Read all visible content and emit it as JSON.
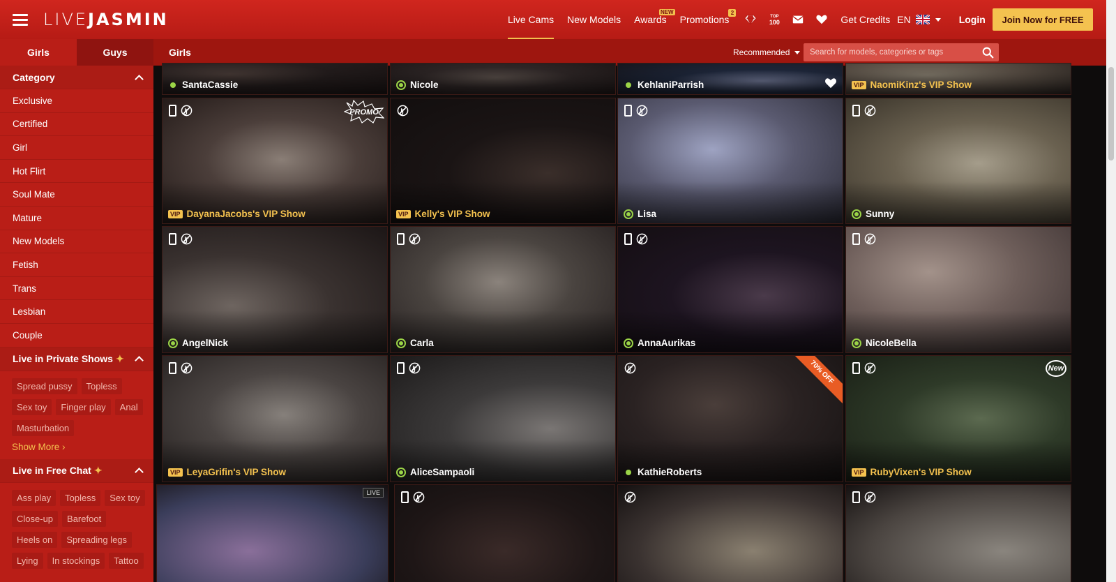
{
  "brand": {
    "logo_thin": "LIVE",
    "logo_bold": "JASMIN"
  },
  "nav": {
    "live_cams": "Live Cams",
    "new_models": "New Models",
    "awards": "Awards",
    "awards_badge": "NEW",
    "promotions": "Promotions",
    "promotions_count": "2",
    "top100_line1": "TOP",
    "top100_line2": "100",
    "get_credits": "Get Credits",
    "lang": "EN",
    "login": "Login",
    "join": "Join Now for FREE"
  },
  "sidebar": {
    "tabs": [
      "Girls",
      "Guys"
    ],
    "category_title": "Category",
    "categories": [
      "Exclusive",
      "Certified",
      "Girl",
      "Hot Flirt",
      "Soul Mate",
      "Mature",
      "New Models",
      "Fetish",
      "Trans",
      "Lesbian",
      "Couple"
    ],
    "private_title": "Live in Private Shows",
    "private_tags": [
      "Spread pussy",
      "Topless",
      "Sex toy",
      "Finger play",
      "Anal",
      "Masturbation"
    ],
    "show_more": "Show More",
    "free_title": "Live in Free Chat",
    "free_tags": [
      "Ass play",
      "Topless",
      "Sex toy",
      "Close-up",
      "Barefoot",
      "Heels on",
      "Spreading legs",
      "Lying",
      "In stockings",
      "Tattoo"
    ]
  },
  "subheader": {
    "title": "Girls",
    "sort": "Recommended",
    "search_placeholder": "Search for models, categories or tags"
  },
  "cards": [
    {
      "name": "SantaCassie",
      "status": "dot"
    },
    {
      "name": "Nicole",
      "status": "ring"
    },
    {
      "name": "KehlaniParrish",
      "status": "dot",
      "heart": true
    },
    {
      "name": "NaomiKinz's VIP Show",
      "status": "vip"
    },
    {
      "name": "DayanaJacobs's VIP Show",
      "status": "vip",
      "promo": "PROMO"
    },
    {
      "name": "Kelly's VIP Show",
      "status": "vip"
    },
    {
      "name": "Lisa",
      "status": "ring"
    },
    {
      "name": "Sunny",
      "status": "ring"
    },
    {
      "name": "AngelNick",
      "status": "ring"
    },
    {
      "name": "Carla",
      "status": "ring"
    },
    {
      "name": "AnnaAurikas",
      "status": "ring"
    },
    {
      "name": "NicoleBella",
      "status": "ring"
    },
    {
      "name": "LeyaGrifin's VIP Show",
      "status": "vip"
    },
    {
      "name": "AliceSampaoli",
      "status": "ring"
    },
    {
      "name": "KathieRoberts",
      "status": "dot",
      "ribbon": "70% OFF"
    },
    {
      "name": "RubyVixen's VIP Show",
      "status": "vip",
      "new_badge": "New"
    }
  ],
  "vip_label": "VIP",
  "live_label": "LIVE",
  "colors": {
    "brand_red": "#c4221a",
    "accent_yellow": "#f4c24f",
    "online_green": "#9bd447"
  }
}
